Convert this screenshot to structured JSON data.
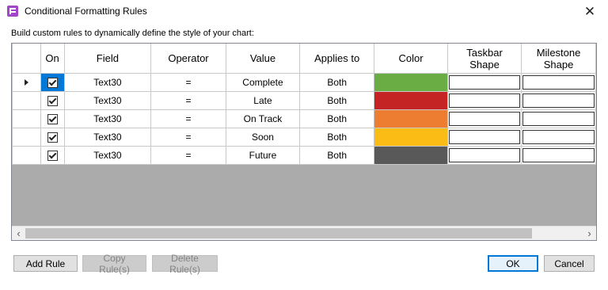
{
  "window": {
    "title": "Conditional Formatting Rules",
    "close_glyph": "✕",
    "icon": "app-rules-icon"
  },
  "instruction": "Build custom rules to dynamically define the style of your chart:",
  "grid": {
    "columns": [
      {
        "key": "on",
        "label": "On"
      },
      {
        "key": "field",
        "label": "Field"
      },
      {
        "key": "operator",
        "label": "Operator"
      },
      {
        "key": "value",
        "label": "Value"
      },
      {
        "key": "applies_to",
        "label": "Applies to"
      },
      {
        "key": "color",
        "label": "Color"
      },
      {
        "key": "taskbar_shape",
        "label": "Taskbar\nShape"
      },
      {
        "key": "milestone_shape",
        "label": "Milestone\nShape"
      }
    ],
    "rows": [
      {
        "on": true,
        "field": "Text30",
        "operator": "=",
        "value": "Complete",
        "applies_to": "Both",
        "color": "#6aad45",
        "current": true
      },
      {
        "on": true,
        "field": "Text30",
        "operator": "=",
        "value": "Late",
        "applies_to": "Both",
        "color": "#c52425",
        "current": false
      },
      {
        "on": true,
        "field": "Text30",
        "operator": "=",
        "value": "On Track",
        "applies_to": "Both",
        "color": "#ed7d31",
        "current": false
      },
      {
        "on": true,
        "field": "Text30",
        "operator": "=",
        "value": "Soon",
        "applies_to": "Both",
        "color": "#fbbc15",
        "current": false
      },
      {
        "on": true,
        "field": "Text30",
        "operator": "=",
        "value": "Future",
        "applies_to": "Both",
        "color": "#595959",
        "current": false
      }
    ]
  },
  "scrollbar": {
    "left": "‹",
    "right": "›"
  },
  "buttons": {
    "add": "Add Rule",
    "copy": "Copy Rule(s)",
    "delete": "Delete Rule(s)",
    "ok": "OK",
    "cancel": "Cancel"
  }
}
